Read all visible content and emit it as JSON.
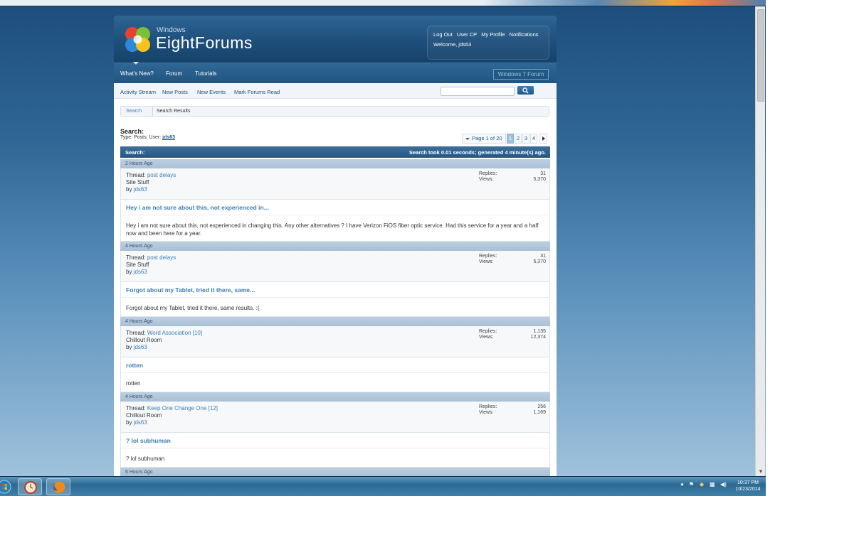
{
  "header": {
    "logo_small": "Windows",
    "logo_main": "EightForums",
    "user_links": [
      "Log Out",
      "User CP",
      "My Profile",
      "Notifications"
    ],
    "welcome": "Welcome, jds63"
  },
  "nav": {
    "tabs": [
      "What's New?",
      "Forum",
      "Tutorials"
    ],
    "windows7_button": "Windows 7 Forum"
  },
  "subnav": {
    "links": [
      "Activity Stream",
      "New Posts",
      "New Events",
      "Mark Forums Read"
    ],
    "search_placeholder": ""
  },
  "breadcrumb": {
    "root": "Search",
    "current": "Search Results"
  },
  "results_header": {
    "title": "Search:",
    "meta_prefix": "Type: Posts; User:",
    "meta_user": "jds63"
  },
  "pager": {
    "label": "Page 1 of 20",
    "pages": [
      "1",
      "2",
      "3",
      "4"
    ],
    "current": "1"
  },
  "results_bar": {
    "left": "Search:",
    "right": "Search took 0.01 seconds; generated 4 minute(s) ago."
  },
  "stat_labels": {
    "replies": "Replies:",
    "views": "Views:"
  },
  "results": [
    {
      "time": "2 Hours Ago",
      "thread_prefix": "Thread:",
      "thread": "post delays",
      "forum": "Site Stuff",
      "by_prefix": "by",
      "user": "jds63",
      "replies": "31",
      "views": "5,370",
      "title": "Hey i am not sure about this, not experienced in...",
      "body": "Hey i am not sure about this, not experienced in changing this. Any other alternatives ? I have Verizon FiOS fiber optic service. Had this service for a year and a half now and been here for a year."
    },
    {
      "time": "4 Hours Ago",
      "thread_prefix": "Thread:",
      "thread": "post delays",
      "forum": "Site Stuff",
      "by_prefix": "by",
      "user": "jds63",
      "replies": "31",
      "views": "5,370",
      "title": "Forgot about my Tablet, tried it there, same...",
      "body": "Forgot about my Tablet, tried it there, same results. :("
    },
    {
      "time": "4 Hours Ago",
      "thread_prefix": "Thread:",
      "thread": "Word Association [10]",
      "forum": "Chillout Room",
      "by_prefix": "by",
      "user": "jds63",
      "replies": "1,135",
      "views": "12,374",
      "title": "rotten",
      "body": "rotten"
    },
    {
      "time": "4 Hours Ago",
      "thread_prefix": "Thread:",
      "thread": "Keep One Change One [12]",
      "forum": "Chillout Room",
      "by_prefix": "by",
      "user": "jds63",
      "replies": "256",
      "views": "1,169",
      "title": "? lol subhuman",
      "body": "? lol subhuman"
    },
    {
      "time": "6 Hours Ago"
    }
  ],
  "taskbar": {
    "clock_time": "10:37 PM",
    "clock_date": "10/23/2014",
    "tray_icons": [
      "show-hidden-icon",
      "flag-icon",
      "shield-icon",
      "network-icon",
      "volume-icon"
    ]
  },
  "colors": {
    "accent_link": "#3d7fb4",
    "header_blue": "#1e4f7b",
    "bar_blue": "#27567f"
  }
}
